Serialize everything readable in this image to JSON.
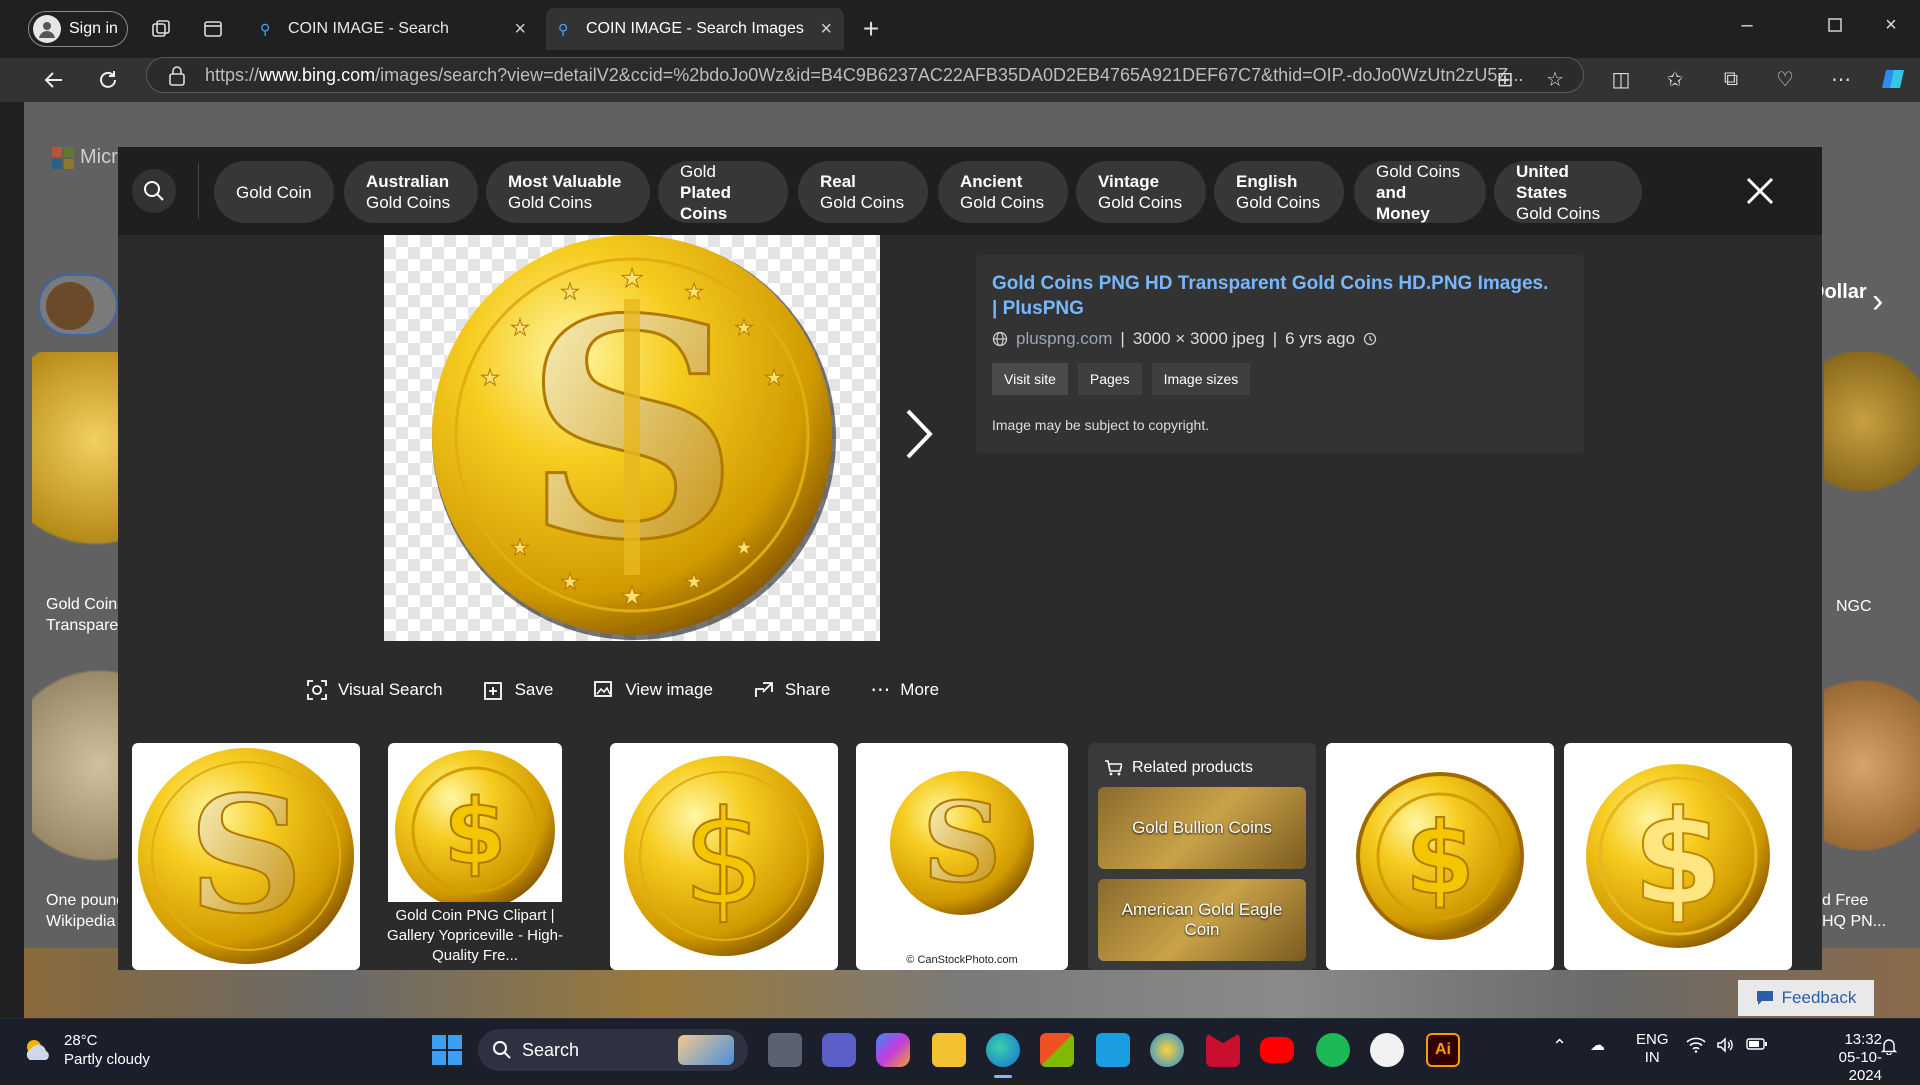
{
  "browser": {
    "signin_label": "Sign in",
    "tabs": [
      {
        "title": "COIN IMAGE - Search"
      },
      {
        "title": "COIN IMAGE - Search Images"
      }
    ],
    "url_prefix": "https://",
    "url_domain": "www.bing.com",
    "url_path": "/images/search?view=detailV2&ccid=%2bdoJo0Wz&id=B4C9B6237AC22AFB35DA0D2EB4765A921DEF67C7&thid=OIP.-doJo0WzUtn2zU5Z..."
  },
  "chips": [
    {
      "line1": "Gold Coin",
      "line2": ""
    },
    {
      "line1": "Australian",
      "line2": "Gold Coins"
    },
    {
      "line1": "Most Valuable",
      "line2": "Gold Coins"
    },
    {
      "line1": "Gold",
      "line2": "Plated Coins"
    },
    {
      "line1": "Real",
      "line2": "Gold Coins"
    },
    {
      "line1": "Ancient",
      "line2": "Gold Coins"
    },
    {
      "line1": "Vintage",
      "line2": "Gold Coins"
    },
    {
      "line1": "English",
      "line2": "Gold Coins"
    },
    {
      "line1": "Gold Coins",
      "line2": "and Money"
    },
    {
      "line1": "United States",
      "line2": "Gold Coins"
    }
  ],
  "detail": {
    "title": "Gold Coins PNG HD Transparent Gold Coins HD.PNG Images. | PlusPNG",
    "site": "pluspng.com",
    "size": "3000 × 3000 jpeg",
    "age": "6 yrs ago",
    "buttons": [
      "Visit site",
      "Pages",
      "Image sizes"
    ],
    "copyright": "Image may be subject to copyright."
  },
  "actions": [
    "Visual Search",
    "Save",
    "View image",
    "Share",
    "More"
  ],
  "thumbs": {
    "caption_2": "Gold Coin PNG Clipart | Gallery Yopriceville - High-Quality Fre...",
    "watermark_4": "© CanStockPhoto.com"
  },
  "related": {
    "heading": "Related products",
    "items": [
      "Gold Bullion Coins",
      "American Gold Eagle Coin"
    ]
  },
  "background_page": {
    "logo_text": "Micr",
    "left_caption_1": "Gold Coins",
    "left_caption_2": "Transpare",
    "left_caption_3": "One pound",
    "left_caption_4": "Wikipedia",
    "right_text_1": "Dollar",
    "right_text_2": "s",
    "right_caption_1": "NGC",
    "right_caption_2": "d Free",
    "right_caption_3": "HQ PN...",
    "feedback_label": "Feedback"
  },
  "taskbar": {
    "temperature": "28°C",
    "weather": "Partly cloudy",
    "search_label": "Search",
    "lang_1": "ENG",
    "lang_2": "IN",
    "time": "13:32",
    "date": "05-10-2024"
  },
  "colors": {
    "link_blue": "#77b7ff",
    "gold": "#f2c200",
    "modal_bg": "#2b2b2b"
  }
}
